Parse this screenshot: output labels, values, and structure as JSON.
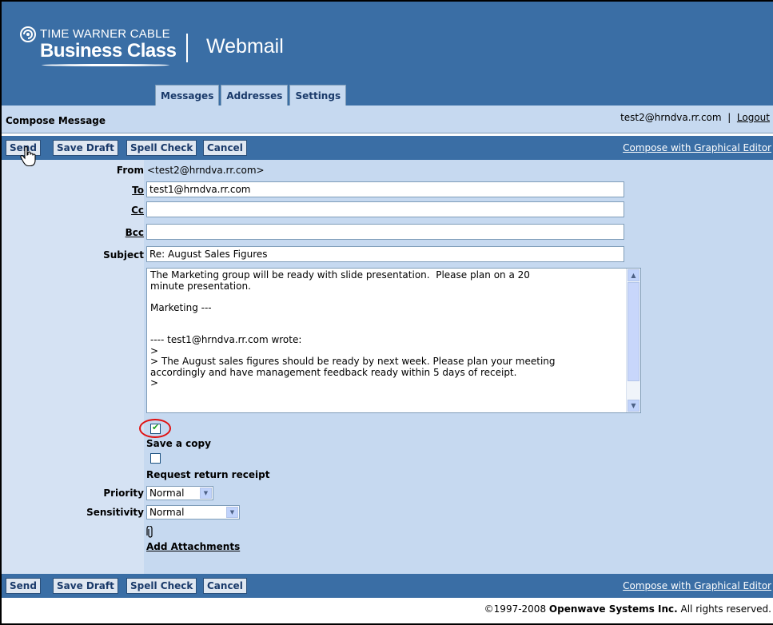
{
  "brand": {
    "line1": "TIME WARNER CABLE",
    "line2": "Business Class"
  },
  "app": {
    "title": "Webmail"
  },
  "tabs": [
    {
      "label": "Messages"
    },
    {
      "label": "Addresses"
    },
    {
      "label": "Settings"
    }
  ],
  "subheader": {
    "page_title": "Compose Message",
    "user_email": "test2@hrndva.rr.com",
    "separator": "|",
    "logout": "Logout"
  },
  "toolbar": {
    "send": "Send",
    "save_draft": "Save Draft",
    "spell_check": "Spell Check",
    "cancel": "Cancel",
    "graphical_editor": "Compose with Graphical Editor"
  },
  "form": {
    "from_label": "From",
    "from_value": "<test2@hrndva.rr.com>",
    "to_label": "To",
    "to_value": "test1@hrndva.rr.com",
    "cc_label": "Cc",
    "cc_value": "",
    "bcc_label": "Bcc",
    "bcc_value": "",
    "subject_label": "Subject",
    "subject_value": "Re: August Sales Figures",
    "body": "The Marketing group will be ready with slide presentation.  Please plan on a 20\nminute presentation.\n\nMarketing ---\n\n\n---- test1@hrndva.rr.com wrote:\n>\n> The August sales figures should be ready by next week. Please plan your meeting\naccordingly and have management feedback ready within 5 days of receipt.\n>",
    "save_copy_label": "Save a copy",
    "save_copy_checked": true,
    "return_receipt_label": "Request return receipt",
    "return_receipt_checked": false,
    "priority_label": "Priority",
    "priority_value": "Normal",
    "sensitivity_label": "Sensitivity",
    "sensitivity_value": "Normal",
    "attachments_label": "Add Attachments"
  },
  "footer": {
    "copyright": "©1997-2008 ",
    "company": "Openwave Systems Inc.",
    "rights": " All rights reserved."
  },
  "colors": {
    "header": "#3a6ea5",
    "panel": "#c6d9f0",
    "highlight_circle": "#e01010"
  },
  "icons": {
    "brand_logo": "swirl-logo-icon",
    "attachment": "paperclip-icon",
    "cursor": "hand-pointer-icon"
  }
}
